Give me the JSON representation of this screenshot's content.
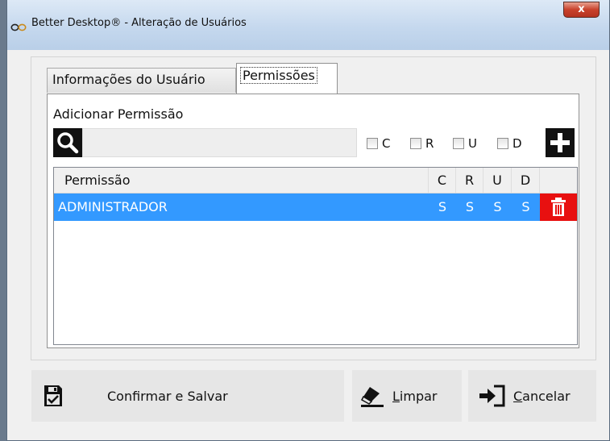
{
  "window": {
    "title": "Better Desktop® - Alteração de Usuários",
    "close_label": "x"
  },
  "tabs": [
    {
      "label": "Informações do Usuário",
      "active": false
    },
    {
      "label": "Permissões",
      "active": true
    }
  ],
  "permissions_panel": {
    "add_label": "Adicionar Permissão",
    "search_value": "",
    "checks": [
      {
        "label": "C",
        "checked": false
      },
      {
        "label": "R",
        "checked": false
      },
      {
        "label": "U",
        "checked": false
      },
      {
        "label": "D",
        "checked": false
      }
    ]
  },
  "table": {
    "columns": [
      "Permissão",
      "C",
      "R",
      "U",
      "D",
      ""
    ],
    "rows": [
      {
        "name": "ADMINISTRADOR",
        "c": "S",
        "r": "S",
        "u": "S",
        "d": "S",
        "selected": true
      }
    ]
  },
  "actions": {
    "confirm_label": "Confirmar e Salvar",
    "clear_label_first": "L",
    "clear_label_rest": "impar",
    "cancel_label_first": "C",
    "cancel_label_rest": "ancelar"
  },
  "colors": {
    "selection": "#3399ff",
    "delete": "#e81010",
    "icon_dark": "#111111"
  },
  "icons": {
    "app": "infinity-logo-icon",
    "search": "search-icon",
    "add": "plus-icon",
    "delete": "trash-icon",
    "confirm": "save-check-icon",
    "clear": "eraser-icon",
    "cancel": "sign-in-icon"
  }
}
